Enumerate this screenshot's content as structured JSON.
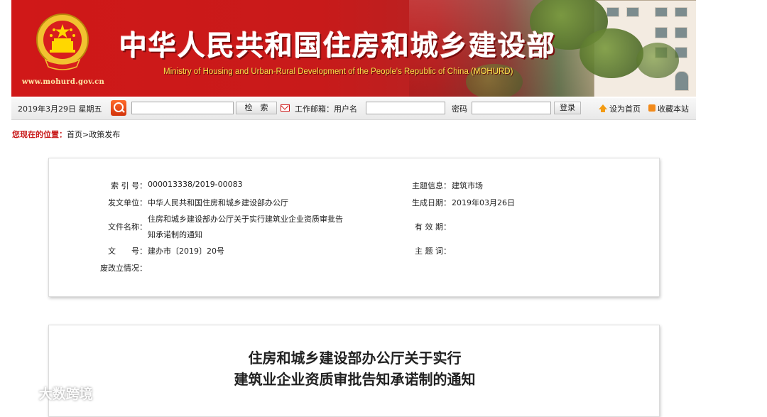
{
  "header": {
    "cn_title": "中华人民共和国住房和城乡建设部",
    "en_title": "Ministry of Housing and Urban-Rural Development of the People's Republic of China (MOHURD)",
    "site_url": "www.mohurd.gov.cn",
    "emblem_icon": "national-emblem-icon",
    "colors": {
      "banner_red": "#d01818",
      "title_white": "#ffffff",
      "subtitle_yellow": "#ffe24a"
    }
  },
  "toolbar": {
    "date": "2019年3月29日 星期五",
    "search_value": "",
    "search_button": "检　索",
    "mail_label": "工作邮箱：用户名",
    "username_value": "",
    "password_label": "密码",
    "password_value": "",
    "login_button": "登录",
    "set_home": "设为首页",
    "bookmark": "收藏本站",
    "icons": [
      "search-icon",
      "mail-icon",
      "home-icon",
      "rss-icon"
    ]
  },
  "breadcrumb": {
    "lead": "您现在的位置：",
    "home": "首页",
    "sep": ">",
    "current": "政策发布"
  },
  "info": {
    "index_label": "索 引 号：",
    "index_value": "000013338/2019-00083",
    "topic_label": "主题信息：",
    "topic_value": "建筑市场",
    "issuer_label": "发文单位：",
    "issuer_value": "中华人民共和国住房和城乡建设部办公厅",
    "date_label": "生成日期：",
    "date_value": "2019年03月26日",
    "name_label": "文件名称：",
    "name_line1": "住房和城乡建设部办公厅关于实行建筑业企业资质审批告",
    "name_line2": "知承诺制的通知",
    "validity_label": "有 效 期：",
    "validity_value": "",
    "docnum_label": "文　　号：",
    "docnum_value": "建办市〔2019〕20号",
    "keyword_label": "主 题 词：",
    "keyword_value": "",
    "status_label": "废改立情况：",
    "status_value": ""
  },
  "document": {
    "title_line1": "住房和城乡建设部办公厅关于实行",
    "title_line2": "建筑业企业资质审批告知承诺制的通知"
  },
  "watermark": {
    "text": "大数跨境",
    "icon": "wechat-logo-icon"
  }
}
